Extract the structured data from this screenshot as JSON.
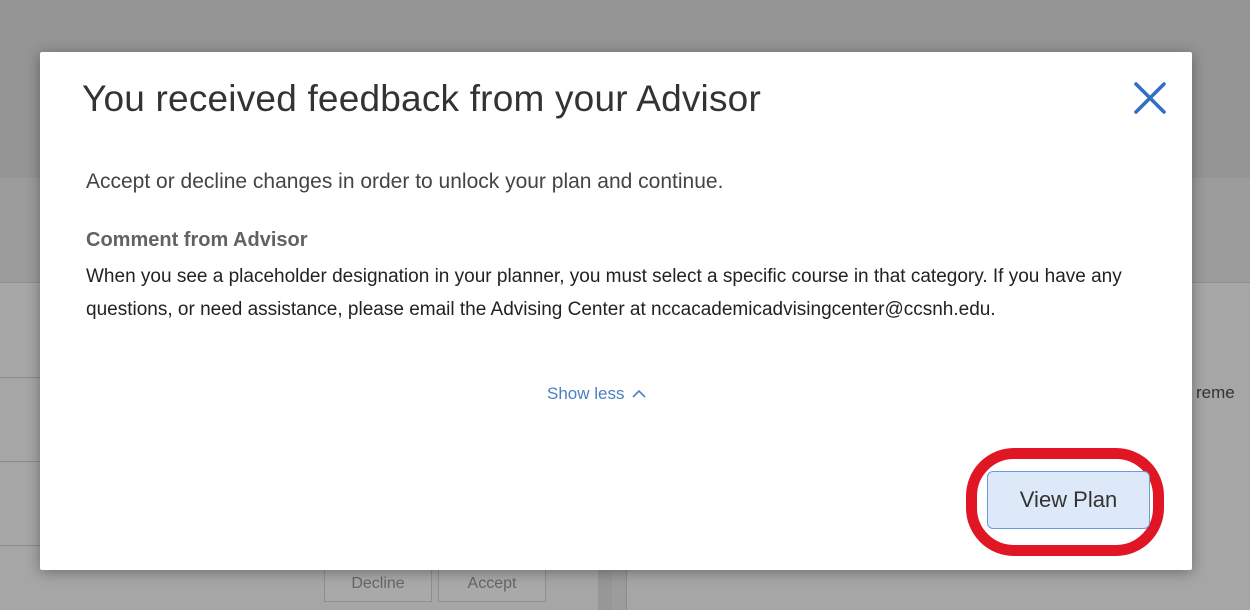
{
  "modal": {
    "title": "You received feedback from your Advisor",
    "intro": "Accept or decline changes in order to unlock your plan and continue.",
    "comment_heading": "Comment from Advisor",
    "comment_body": "When you see a placeholder designation in your planner, you must select a specific course in that category. If you have any questions, or need assistance, please email the Advising Center at nccacademicadvisingcenter@ccsnh.edu.",
    "show_less_label": "Show less",
    "view_plan_label": "View Plan",
    "close_icon": "close-icon"
  },
  "background": {
    "right_panel_text_fragment": "reme",
    "decline_label": "Decline",
    "accept_label": "Accept"
  },
  "colors": {
    "accent": "#2f6fc4",
    "link": "#4a7fc1",
    "highlight": "#e01624",
    "button_fill": "#dde9f8",
    "overlay": "#9a9a9a"
  }
}
